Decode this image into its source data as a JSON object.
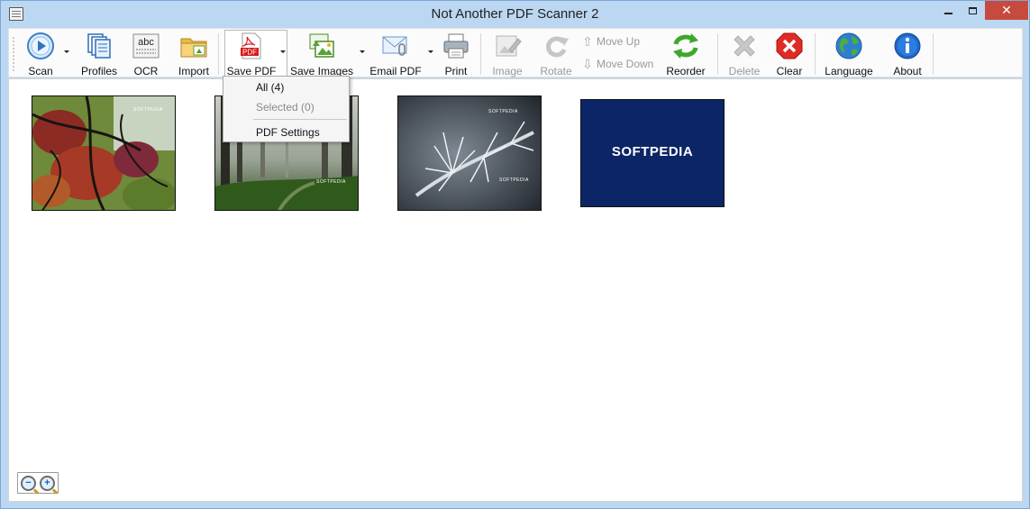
{
  "window": {
    "title": "Not Another PDF Scanner 2",
    "controls": {
      "minimize": "",
      "maximize": "",
      "close": "✕"
    }
  },
  "toolbar": {
    "scan": "Scan",
    "profiles": "Profiles",
    "ocr": "OCR",
    "ocr_icon_text": "abc",
    "import": "Import",
    "save_pdf": "Save PDF",
    "save_pdf_icon_text": "PDF",
    "save_images": "Save Images",
    "email_pdf": "Email PDF",
    "print": "Print",
    "image": "Image",
    "rotate": "Rotate",
    "move_up": "Move Up",
    "move_down": "Move Down",
    "reorder": "Reorder",
    "delete": "Delete",
    "clear": "Clear",
    "language": "Language",
    "about": "About"
  },
  "save_pdf_menu": {
    "all": "All (4)",
    "selected": "Selected (0)",
    "pdf_settings": "PDF Settings"
  },
  "thumbnails": [
    {
      "watermark": "SOFTPEDIA"
    },
    {
      "watermark": "SOFTPEDIA"
    },
    {
      "watermark": "SOFTPEDIA"
    },
    {
      "watermark": "SOFTPEDIA"
    }
  ],
  "zoom": {
    "out": "−",
    "in": "+"
  },
  "colors": {
    "window_frame": "#bcd7f2",
    "close_button": "#c74a3f",
    "softpedia_blue": "#0c2566"
  }
}
